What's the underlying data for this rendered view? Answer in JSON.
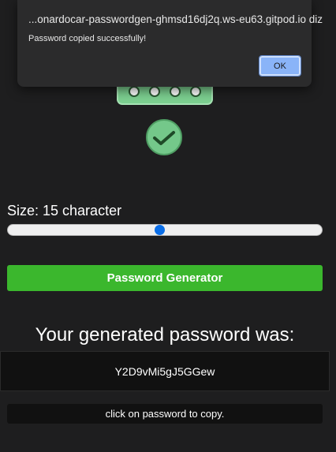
{
  "colors": {
    "background": "#1e1e1f",
    "accent_green": "#3bb72d",
    "slider_thumb": "#0a6ee8",
    "dialog_bg": "#2b2b2c",
    "ok_button": "#8ab4f8",
    "logo_green": "#7ccf90"
  },
  "icons": {
    "logo": "password-dots-icon",
    "check": "checkmark-circle-icon"
  },
  "dialog": {
    "title": "...onardocar-passwordgen-ghmsd16dj2q.ws-eu63.gitpod.io diz",
    "message": "Password copied successfully!",
    "ok_label": "OK"
  },
  "generator": {
    "size_label": "Size: 15 character",
    "slider": {
      "value": 15,
      "min": 1,
      "max": 30
    },
    "button_label": "Password Generator"
  },
  "result": {
    "heading": "Your generated password was:",
    "password": "Y2D9vMi5gJ5GGew",
    "hint": "click on password to copy."
  }
}
